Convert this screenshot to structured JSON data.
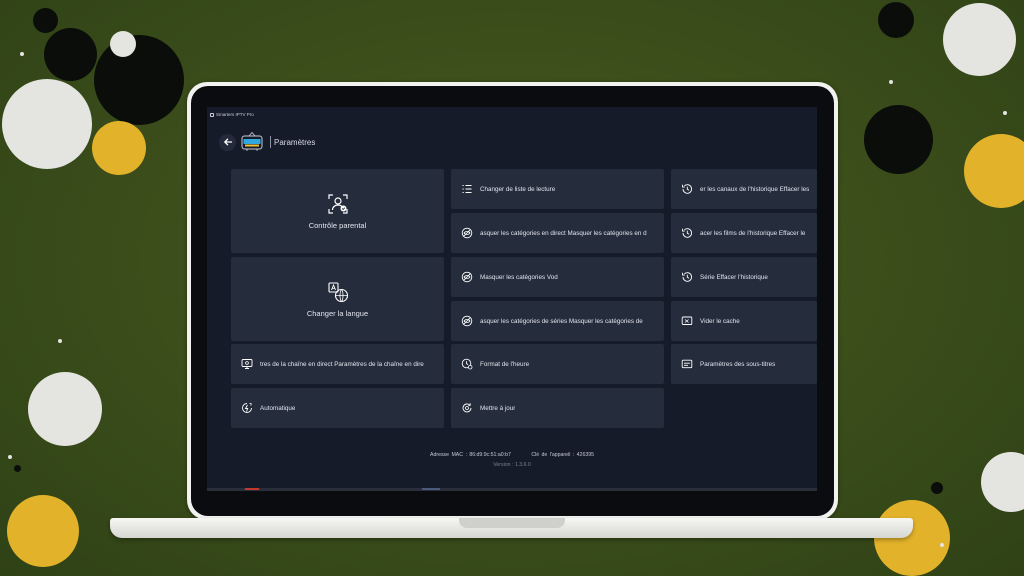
{
  "colors": {
    "background_green": "#3d4f1b",
    "dot_black": "#0a0d09",
    "dot_white": "#e4e4e0",
    "dot_yellow": "#e2b22a",
    "screen_bg": "#161b29",
    "tile_bg": "#252c3c"
  },
  "app": {
    "window_title": "Smarters IPTV Pro",
    "page_title": "Paramètres",
    "logo_icon": "smarters-tv-logo"
  },
  "tiles": {
    "parental": {
      "label": "Contrôle parental",
      "icon": "parental-control-icon"
    },
    "language": {
      "label": "Changer la langue",
      "icon": "translate-icon"
    },
    "live_channel_settings": {
      "label": "tres de la chaîne en direct Paramètres de la chaîne en dire",
      "icon": "tv-settings-icon"
    },
    "automatic": {
      "label": "Automatique",
      "icon": "auto-icon"
    },
    "change_playlist": {
      "label": "Changer de liste de lecture",
      "icon": "list-icon"
    },
    "hide_live_categories": {
      "label": "asquer les catégories en direct Masquer les catégories en d",
      "icon": "eye-off-icon"
    },
    "hide_vod_categories": {
      "label": "Masquer les catégories Vod",
      "icon": "eye-off-icon"
    },
    "hide_series_categories": {
      "label": "asquer les catégories de séries Masquer les catégories de",
      "icon": "eye-off-icon"
    },
    "time_format": {
      "label": "Format de l'heure",
      "icon": "clock-settings-icon"
    },
    "update": {
      "label": "Mettre à jour",
      "icon": "update-icon"
    },
    "clear_channels_history": {
      "label": "er les canaux de l'historique Effacer les",
      "icon": "history-icon"
    },
    "clear_movies_history": {
      "label": "acer les films de l'historique Effacer le",
      "icon": "history-icon"
    },
    "clear_series_history": {
      "label": "Série Effacer l'historique",
      "icon": "history-icon"
    },
    "clear_cache": {
      "label": "Vider le cache",
      "icon": "clear-cache-icon"
    },
    "subtitle_settings": {
      "label": "Paramètres des sous-titres",
      "icon": "subtitles-icon"
    }
  },
  "footer": {
    "mac": "Adresse MAC : 86:d9:9c:51:a0:b7",
    "device_key": "Clé de l'appareil : 426395",
    "version": "Version : 1.3.6.0"
  }
}
